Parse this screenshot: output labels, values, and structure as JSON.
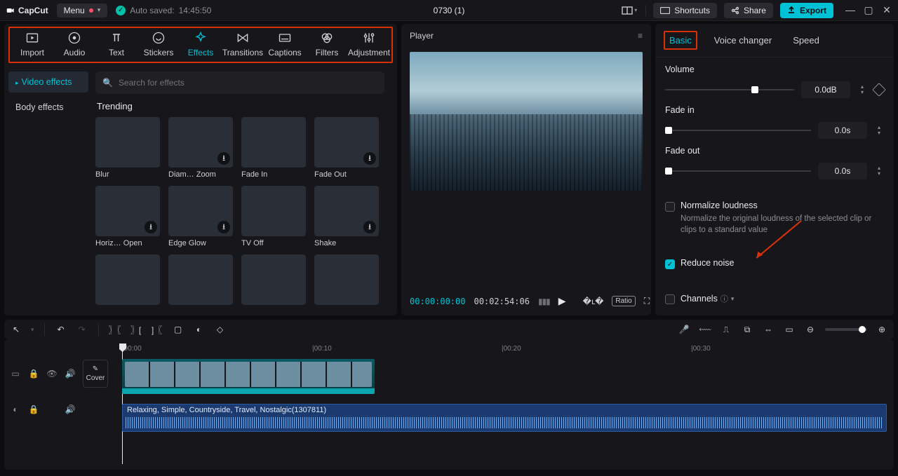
{
  "titlebar": {
    "app": "CapCut",
    "menu": "Menu",
    "autosave_label": "Auto saved:",
    "autosave_time": "14:45:50",
    "title": "0730 (1)",
    "shortcuts": "Shortcuts",
    "share": "Share",
    "export": "Export"
  },
  "toolTabs": [
    {
      "key": "import",
      "label": "Import"
    },
    {
      "key": "audio",
      "label": "Audio"
    },
    {
      "key": "text",
      "label": "Text"
    },
    {
      "key": "stickers",
      "label": "Stickers"
    },
    {
      "key": "effects",
      "label": "Effects"
    },
    {
      "key": "transitions",
      "label": "Transitions"
    },
    {
      "key": "captions",
      "label": "Captions"
    },
    {
      "key": "filters",
      "label": "Filters"
    },
    {
      "key": "adjustment",
      "label": "Adjustment"
    }
  ],
  "sideTabs": {
    "video": "Video effects",
    "body": "Body effects"
  },
  "search": {
    "placeholder": "Search for effects"
  },
  "sectionTitle": "Trending",
  "thumbs": [
    {
      "label": "Blur",
      "cls": "img-blur",
      "dl": false
    },
    {
      "label": "Diam… Zoom",
      "cls": "img-diamond",
      "dl": true
    },
    {
      "label": "Fade In",
      "cls": "img-city",
      "dl": false
    },
    {
      "label": "Fade Out",
      "cls": "img-fade",
      "dl": true
    },
    {
      "label": "Horiz… Open",
      "cls": "img-horizon",
      "dl": true
    },
    {
      "label": "Edge Glow",
      "cls": "img-edge",
      "dl": true
    },
    {
      "label": "TV Off",
      "cls": "img-tvoff",
      "dl": false
    },
    {
      "label": "Shake",
      "cls": "img-shake",
      "dl": true
    },
    {
      "label": "",
      "cls": "img-shade",
      "dl": false
    },
    {
      "label": "",
      "cls": "img-person",
      "dl": false
    },
    {
      "label": "",
      "cls": "img-person",
      "dl": false
    },
    {
      "label": "",
      "cls": "img-person",
      "dl": false
    }
  ],
  "player": {
    "title": "Player",
    "currentTime": "00:00:00:00",
    "duration": "00:02:54:06",
    "ratio": "Ratio"
  },
  "rightPanel": {
    "tabs": {
      "basic": "Basic",
      "voice": "Voice changer",
      "speed": "Speed"
    },
    "volume": {
      "label": "Volume",
      "value": "0.0dB"
    },
    "fadeIn": {
      "label": "Fade in",
      "value": "0.0s"
    },
    "fadeOut": {
      "label": "Fade out",
      "value": "0.0s"
    },
    "normalize": {
      "label": "Normalize loudness",
      "desc": "Normalize the original loudness of the selected clip or clips to a standard value"
    },
    "reduceNoise": {
      "label": "Reduce noise"
    },
    "channels": {
      "label": "Channels"
    }
  },
  "timeline": {
    "ruler": [
      "00:00",
      "00:10",
      "00:20",
      "00:30"
    ],
    "cover": "Cover",
    "audioClip": "Relaxing, Simple, Countryside, Travel, Nostalgic(1307811)"
  }
}
